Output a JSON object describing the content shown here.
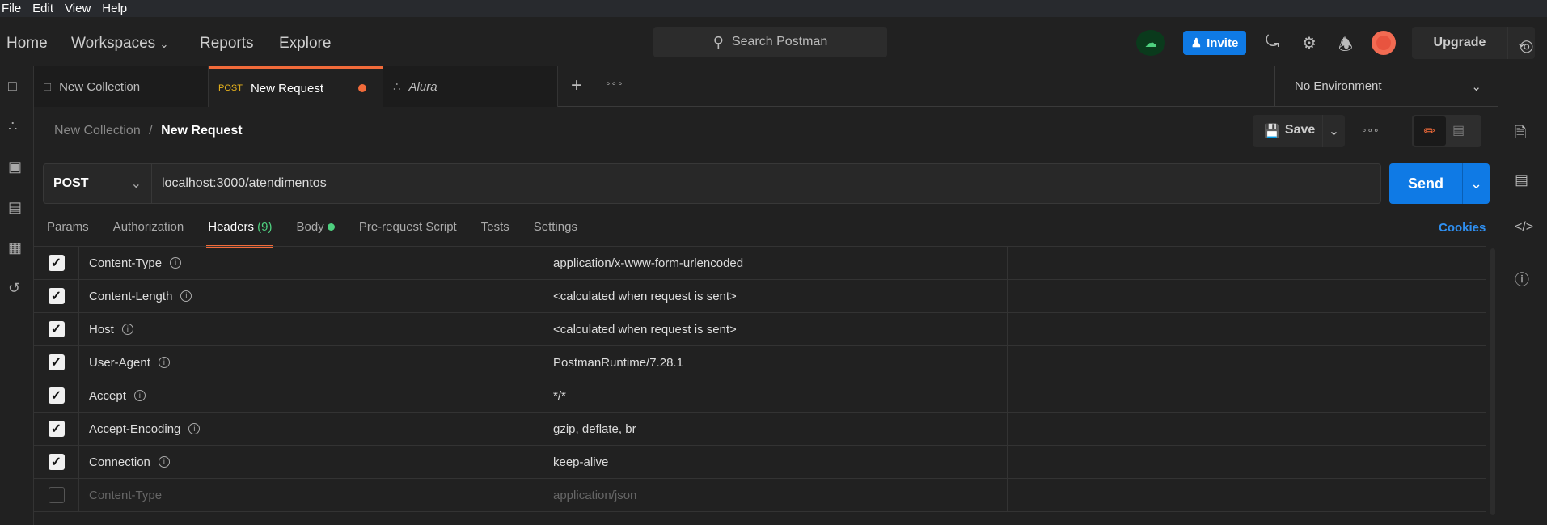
{
  "menu": [
    "File",
    "Edit",
    "View",
    "Help"
  ],
  "nav": {
    "home": "Home",
    "workspaces": "Workspaces",
    "reports": "Reports",
    "explore": "Explore"
  },
  "search": {
    "placeholder": "Search Postman"
  },
  "invite": "Invite",
  "upgrade": "Upgrade",
  "tabs": [
    {
      "label": "New Collection"
    },
    {
      "method": "POST",
      "label": "New Request",
      "unsaved": true
    },
    {
      "label": "Alura"
    }
  ],
  "environment": "No Environment",
  "breadcrumb": {
    "parent": "New Collection",
    "separator": "/",
    "current": "New Request"
  },
  "save": "Save",
  "request": {
    "method": "POST",
    "url": "localhost:3000/atendimentos",
    "send": "Send"
  },
  "request_tabs": [
    {
      "label": "Params"
    },
    {
      "label": "Authorization"
    },
    {
      "label": "Headers",
      "count": "(9)",
      "active": true
    },
    {
      "label": "Body",
      "dot": true
    },
    {
      "label": "Pre-request Script"
    },
    {
      "label": "Tests"
    },
    {
      "label": "Settings"
    }
  ],
  "cookies": "Cookies",
  "headers": [
    {
      "key": "Content-Type",
      "value": "application/x-www-form-urlencoded",
      "checked": true
    },
    {
      "key": "Content-Length",
      "value": "<calculated when request is sent>",
      "checked": true
    },
    {
      "key": "Host",
      "value": "<calculated when request is sent>",
      "checked": true
    },
    {
      "key": "User-Agent",
      "value": "PostmanRuntime/7.28.1",
      "checked": true
    },
    {
      "key": "Accept",
      "value": "*/*",
      "checked": true
    },
    {
      "key": "Accept-Encoding",
      "value": "gzip, deflate, br",
      "checked": true
    },
    {
      "key": "Connection",
      "value": "keep-alive",
      "checked": true
    }
  ],
  "new_header": {
    "key_placeholder": "Content-Type",
    "value_placeholder": "application/json"
  },
  "colors": {
    "accent": "#f26b3a",
    "primary": "#0f7ae5",
    "success": "#4ed07f",
    "method_post": "#e8b31c"
  }
}
